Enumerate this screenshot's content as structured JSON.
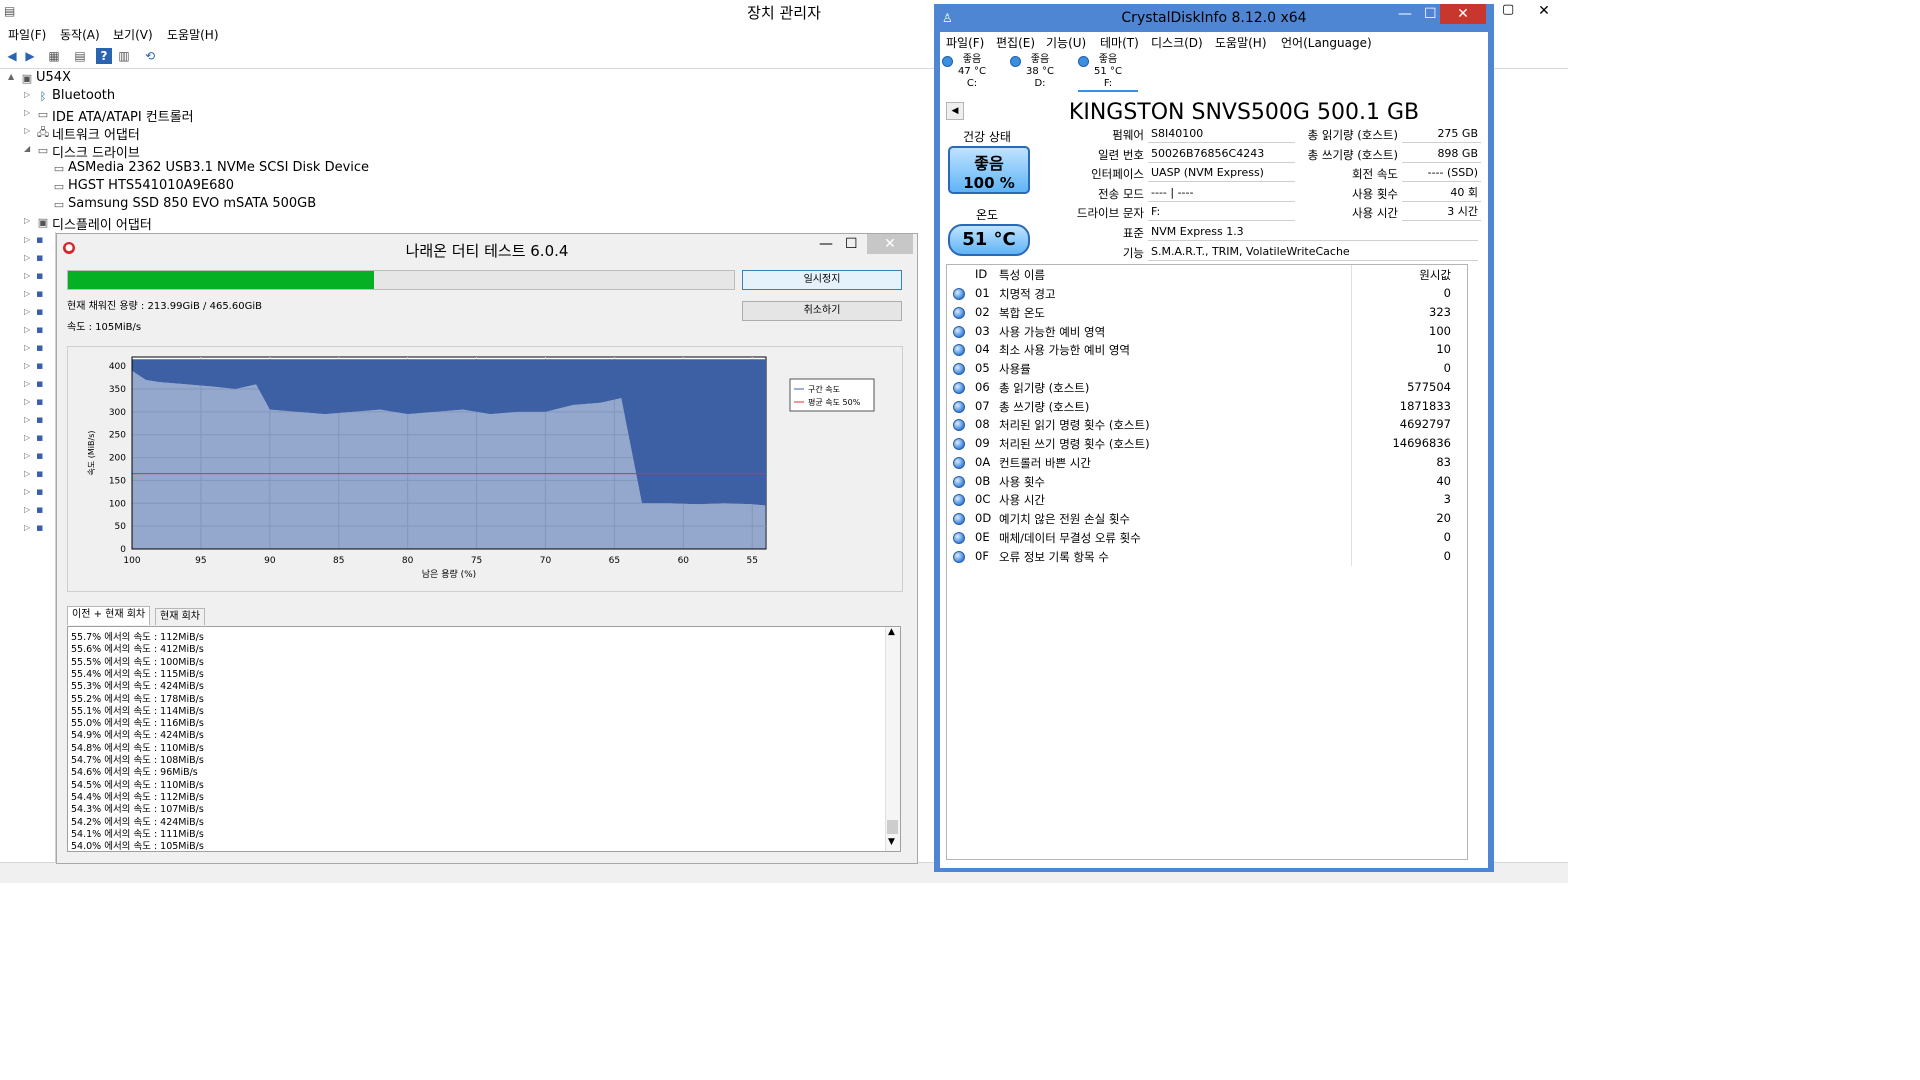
{
  "device_manager": {
    "title": "장치 관리자",
    "menu": [
      "파일(F)",
      "동작(A)",
      "보기(V)",
      "도움말(H)"
    ],
    "tree": [
      {
        "label": "U54X",
        "level": 0,
        "expander": "▲",
        "icon": "computer-icon"
      },
      {
        "label": "Bluetooth",
        "level": 1,
        "expander": "▷",
        "icon": "bluetooth-icon"
      },
      {
        "label": "IDE ATA/ATAPI 컨트롤러",
        "level": 1,
        "expander": "▷",
        "icon": "ide-controller-icon"
      },
      {
        "label": "네트워크 어댑터",
        "level": 1,
        "expander": "▷",
        "icon": "network-adapter-icon"
      },
      {
        "label": "디스크 드라이브",
        "level": 1,
        "expander": "◢",
        "icon": "disk-drive-icon"
      },
      {
        "label": "ASMedia 2362 USB3.1 NVMe SCSI Disk Device",
        "level": 2,
        "expander": "",
        "icon": "disk-icon"
      },
      {
        "label": "HGST HTS541010A9E680",
        "level": 2,
        "expander": "",
        "icon": "disk-icon"
      },
      {
        "label": "Samsung SSD 850 EVO mSATA 500GB",
        "level": 2,
        "expander": "",
        "icon": "disk-icon"
      },
      {
        "label": "디스플레이 어댑터",
        "level": 1,
        "expander": "▷",
        "icon": "display-adapter-icon"
      }
    ],
    "collapsed_icons": [
      "mouse-icon",
      "monitor-icon",
      "bluetooth-device-icon",
      "keyboard-icon",
      "speaker-icon",
      "battery-icon",
      "computer-icon",
      "audio-icon",
      "camera-icon",
      "printer-icon",
      "usb-icon",
      "system-icon",
      "storage-icon",
      "print-queue-icon",
      "processor-icon",
      "network-icon",
      "software-icon"
    ]
  },
  "naraeon": {
    "title": "나래온 더티 테스트 6.0.4",
    "progress_fraction": 0.4595,
    "pause_label": "일시정지",
    "cancel_label": "취소하기",
    "current_capacity_text": "현재 채워진 용량 : 213.99GiB / 465.60GiB",
    "speed_text": "속도 : 105MiB/s",
    "tabs": [
      "이전 + 현재 회차",
      "현재 회차"
    ],
    "log_lines": [
      "55.7% 에서의 속도 : 112MiB/s",
      "55.6% 에서의 속도 : 412MiB/s",
      "55.5% 에서의 속도 : 100MiB/s",
      "55.4% 에서의 속도 : 115MiB/s",
      "55.3% 에서의 속도 : 424MiB/s",
      "55.2% 에서의 속도 : 178MiB/s",
      "55.1% 에서의 속도 : 114MiB/s",
      "55.0% 에서의 속도 : 116MiB/s",
      "54.9% 에서의 속도 : 424MiB/s",
      "54.8% 에서의 속도 : 110MiB/s",
      "54.7% 에서의 속도 : 108MiB/s",
      "54.6% 에서의 속도 : 96MiB/s",
      "54.5% 에서의 속도 : 110MiB/s",
      "54.4% 에서의 속도 : 112MiB/s",
      "54.3% 에서의 속도 : 107MiB/s",
      "54.2% 에서의 속도 : 424MiB/s",
      "54.1% 에서의 속도 : 111MiB/s",
      "54.0% 에서의 속도 : 105MiB/s"
    ]
  },
  "chart_data": {
    "type": "area",
    "xlabel": "남은 용량 (%)",
    "ylabel": "속도 (MiB/s)",
    "xlim": [
      100,
      54
    ],
    "ylim": [
      0,
      420
    ],
    "x_ticks": [
      100,
      95,
      90,
      85,
      80,
      75,
      70,
      65,
      60,
      55
    ],
    "y_ticks": [
      0,
      50,
      100,
      150,
      200,
      250,
      300,
      350,
      400
    ],
    "grid": true,
    "legend_position": "right",
    "series": [
      {
        "name": "구간 속도",
        "color": "#3d5fa3",
        "x": [
          100,
          99,
          98,
          96,
          94,
          92.5,
          91,
          90,
          88,
          86,
          84,
          82,
          80,
          78,
          76,
          74,
          72,
          70,
          68,
          66,
          64.5,
          63,
          61,
          59,
          57,
          55,
          54
        ],
        "y": [
          390,
          370,
          365,
          360,
          355,
          350,
          360,
          305,
          300,
          295,
          300,
          305,
          295,
          300,
          305,
          295,
          300,
          300,
          315,
          320,
          330,
          100,
          100,
          98,
          100,
          98,
          95
        ],
        "top": 415
      },
      {
        "name": "평균 속도 50%",
        "color": "#e03030",
        "x": [
          100,
          54
        ],
        "y": [
          165,
          165
        ]
      }
    ]
  },
  "crystal": {
    "title": "CrystalDiskInfo 8.12.0 x64",
    "menu": [
      "파일(F)",
      "편집(E)",
      "기능(U)",
      "테마(T)",
      "디스크(D)",
      "도움말(H)",
      "언어(Language)"
    ],
    "drives": [
      {
        "status": "좋음",
        "temp": "47 °C",
        "letter": "C:"
      },
      {
        "status": "좋음",
        "temp": "38 °C",
        "letter": "D:"
      },
      {
        "status": "좋음",
        "temp": "51 °C",
        "letter": "F:"
      }
    ],
    "model": "KINGSTON SNVS500G 500.1 GB",
    "health_label": "건강 상태",
    "health_status": "좋음",
    "health_percent": "100 %",
    "temp_label": "온도",
    "temp_value": "51 °C",
    "fields": {
      "firmware_label": "펌웨어",
      "firmware": "S8I40100",
      "serial_label": "일련 번호",
      "serial": "50026B76856C4243",
      "interface_label": "인터페이스",
      "interface": "UASP (NVM Express)",
      "transfer_label": "전송 모드",
      "transfer": "---- | ----",
      "drive_letter_label": "드라이브 문자",
      "drive_letter": "F:",
      "standard_label": "표준",
      "standard": "NVM Express 1.3",
      "features_label": "기능",
      "features": "S.M.A.R.T., TRIM, VolatileWriteCache",
      "total_read_label": "총 읽기량 (호스트)",
      "total_read": "275 GB",
      "total_write_label": "총 쓰기량 (호스트)",
      "total_write": "898 GB",
      "rotation_label": "회전 속도",
      "rotation": "---- (SSD)",
      "power_count_label": "사용 횟수",
      "power_count": "40 회",
      "power_hours_label": "사용 시간",
      "power_hours": "3 시간"
    },
    "smart_header": {
      "id": "ID",
      "name": "특성 이름",
      "raw": "원시값"
    },
    "smart": [
      {
        "id": "01",
        "name": "치명적 경고",
        "raw": "0"
      },
      {
        "id": "02",
        "name": "복합 온도",
        "raw": "323"
      },
      {
        "id": "03",
        "name": "사용 가능한 예비 영역",
        "raw": "100"
      },
      {
        "id": "04",
        "name": "최소 사용 가능한 예비 영역",
        "raw": "10"
      },
      {
        "id": "05",
        "name": "사용률",
        "raw": "0"
      },
      {
        "id": "06",
        "name": "총 읽기량 (호스트)",
        "raw": "577504"
      },
      {
        "id": "07",
        "name": "총 쓰기량 (호스트)",
        "raw": "1871833"
      },
      {
        "id": "08",
        "name": "처리된 읽기 명령 횟수 (호스트)",
        "raw": "4692797"
      },
      {
        "id": "09",
        "name": "처리된 쓰기 명령 횟수 (호스트)",
        "raw": "14696836"
      },
      {
        "id": "0A",
        "name": "컨트롤러 바쁜 시간",
        "raw": "83"
      },
      {
        "id": "0B",
        "name": "사용 횟수",
        "raw": "40"
      },
      {
        "id": "0C",
        "name": "사용 시간",
        "raw": "3"
      },
      {
        "id": "0D",
        "name": "예기치 않은 전원 손실 횟수",
        "raw": "20"
      },
      {
        "id": "0E",
        "name": "매체/데이터 무결성 오류 횟수",
        "raw": "0"
      },
      {
        "id": "0F",
        "name": "오류 정보 기록 항목 수",
        "raw": "0"
      }
    ]
  }
}
